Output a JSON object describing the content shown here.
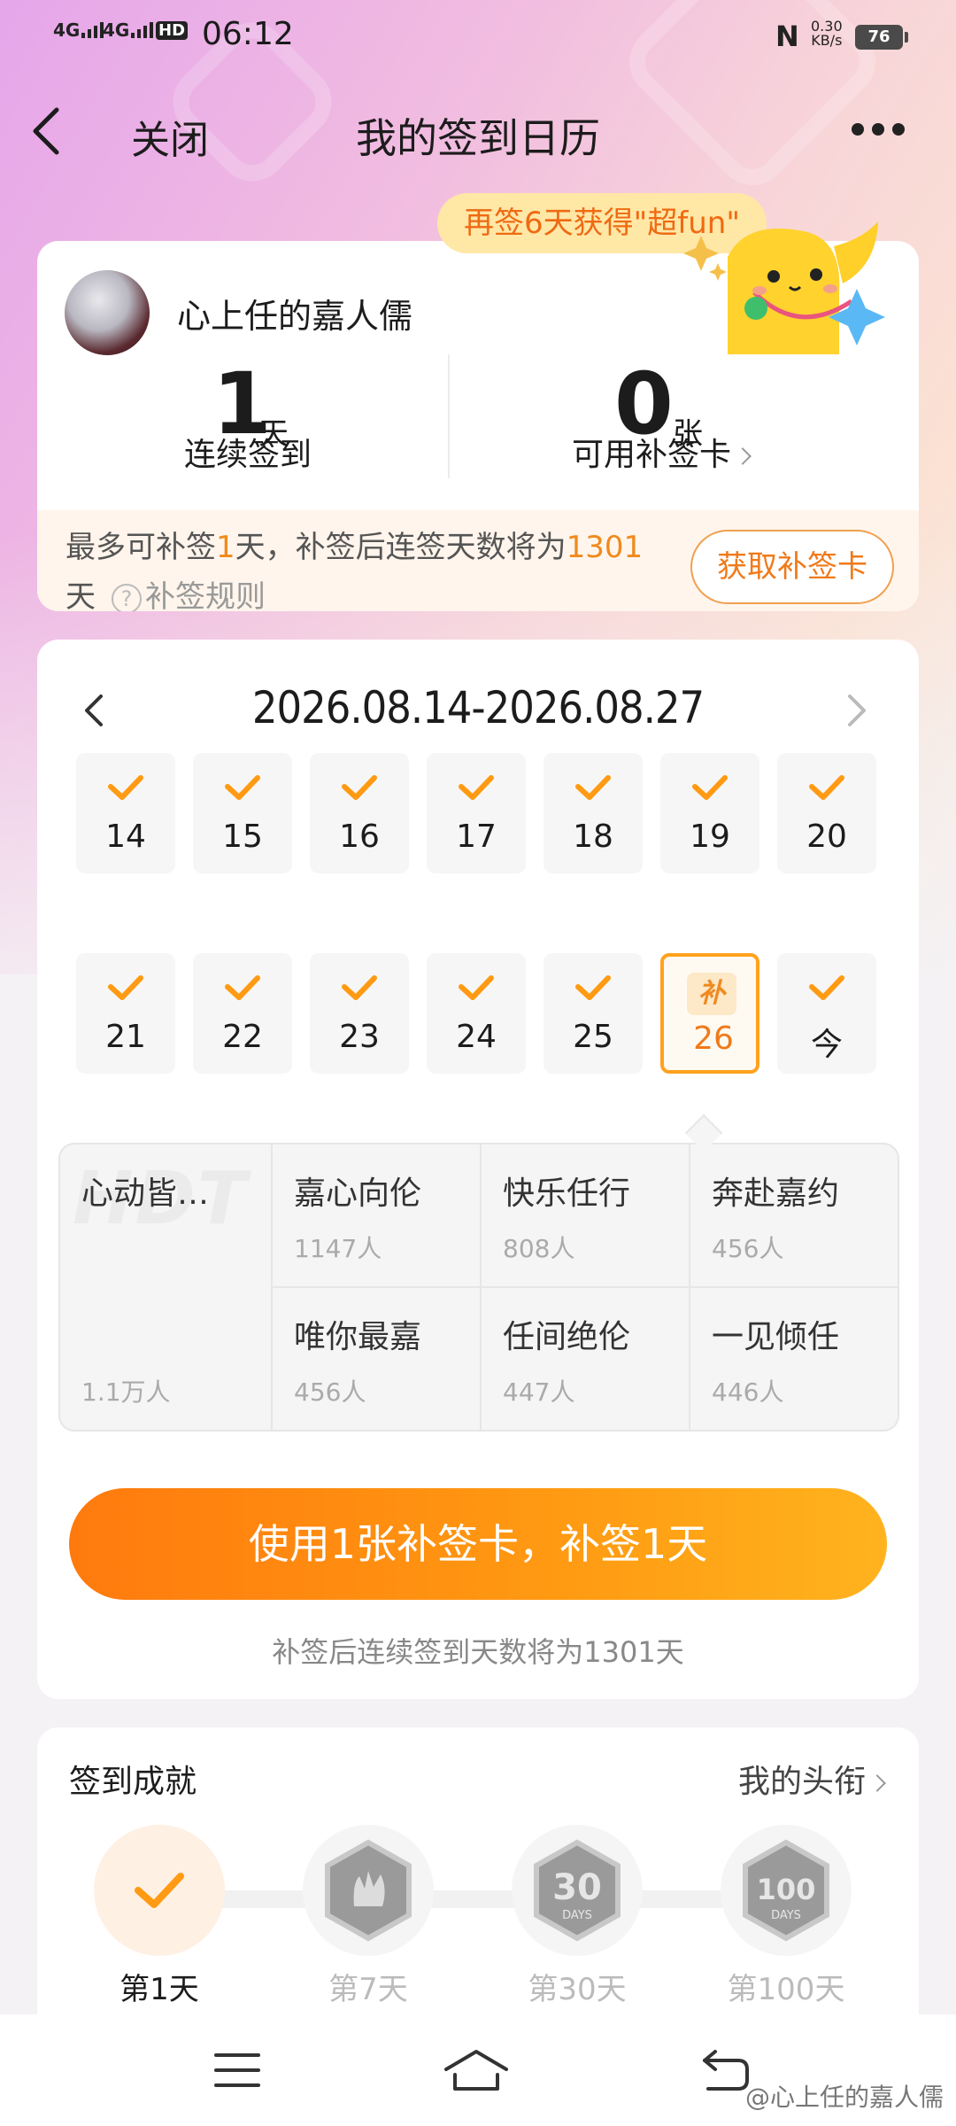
{
  "status_bar": {
    "signal_1": "4G",
    "signal_2": "4G",
    "hd": "HD",
    "time": "06:12",
    "net_speed_value": "0.30",
    "net_speed_unit": "KB/s",
    "battery": "76"
  },
  "nav": {
    "close_label": "关闭",
    "title": "我的签到日历"
  },
  "promo": {
    "text": "再签6天获得\"超fun\""
  },
  "profile": {
    "username": "心上任的嘉人儒",
    "streak_value": "1",
    "streak_unit": "天",
    "streak_label": "连续签到",
    "cards_value": "0",
    "cards_unit": "张",
    "cards_label": "可用补签卡"
  },
  "makeup_info": {
    "prefix": "最多可补签",
    "days": "1",
    "middle": "天，补签后连签天数将为",
    "total": "1301",
    "suffix": "天",
    "rules_label": "补签规则",
    "get_card_button": "获取补签卡"
  },
  "calendar": {
    "range": "2026.08.14-2026.08.27",
    "row1": [
      "14",
      "15",
      "16",
      "17",
      "18",
      "19",
      "20"
    ],
    "row2_checked": [
      "21",
      "22",
      "23",
      "24",
      "25"
    ],
    "makeup_tag": "补",
    "makeup_day": "26",
    "today_label": "今"
  },
  "titles": {
    "watermark": "HDT",
    "featured": {
      "name": "心动皆…",
      "count": "1.1万人"
    },
    "row1": [
      {
        "name": "嘉心向伦",
        "count": "1147人"
      },
      {
        "name": "快乐任行",
        "count": "808人"
      },
      {
        "name": "奔赴嘉约",
        "count": "456人"
      }
    ],
    "row2": [
      {
        "name": "唯你最嘉",
        "count": "456人"
      },
      {
        "name": "任间绝伦",
        "count": "447人"
      },
      {
        "name": "一见倾任",
        "count": "446人"
      }
    ]
  },
  "cta": {
    "button_label": "使用1张补签卡，补签1天",
    "note": "补签后连续签到天数将为1301天"
  },
  "achievements": {
    "title": "签到成就",
    "link": "我的头衔",
    "badges": [
      {
        "label": "第1天"
      },
      {
        "label": "第7天"
      },
      {
        "label": "第30天",
        "badge_text": "30"
      },
      {
        "label": "第100天",
        "badge_text": "100"
      }
    ],
    "badge_sub": "DAYS"
  },
  "watermark": "@心上任的嘉人儒",
  "colors": {
    "accent_orange": "#ff8a14",
    "makeup_border": "#ffa21f"
  }
}
